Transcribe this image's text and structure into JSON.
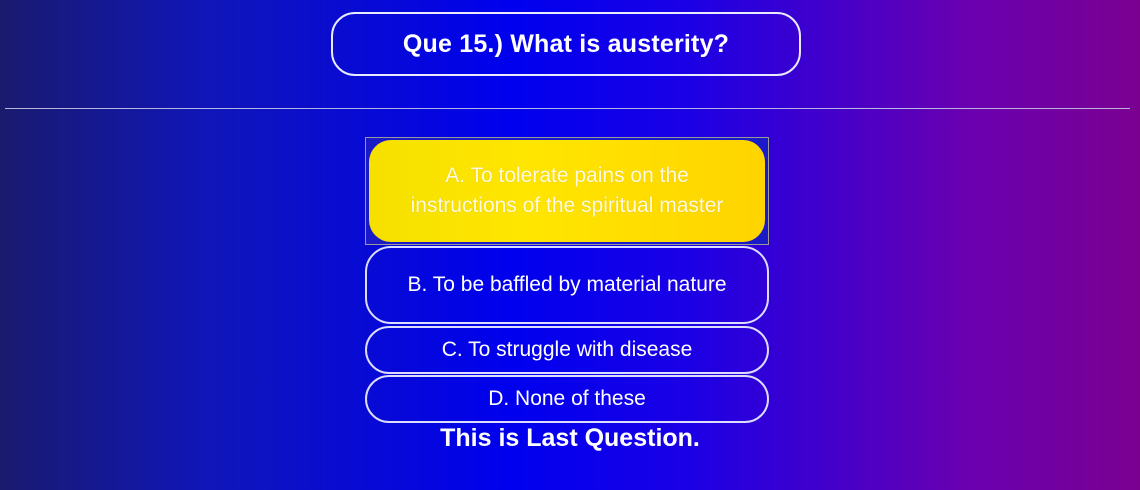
{
  "question": {
    "text": "Que 15.) What is austerity?"
  },
  "options": [
    {
      "label": "A. To tolerate pains on the instructions of the spiritual master",
      "selected": true
    },
    {
      "label": "B. To be baffled by material nature",
      "selected": false
    },
    {
      "label": "C. To struggle with disease",
      "selected": false
    },
    {
      "label": "D. None of these",
      "selected": false
    }
  ],
  "footer": {
    "note": "This is Last Question."
  },
  "colors": {
    "selected_option": "#ffe600",
    "background_left": "#1a1a6e",
    "background_mid": "#0000ee",
    "background_right": "#7a0090"
  }
}
